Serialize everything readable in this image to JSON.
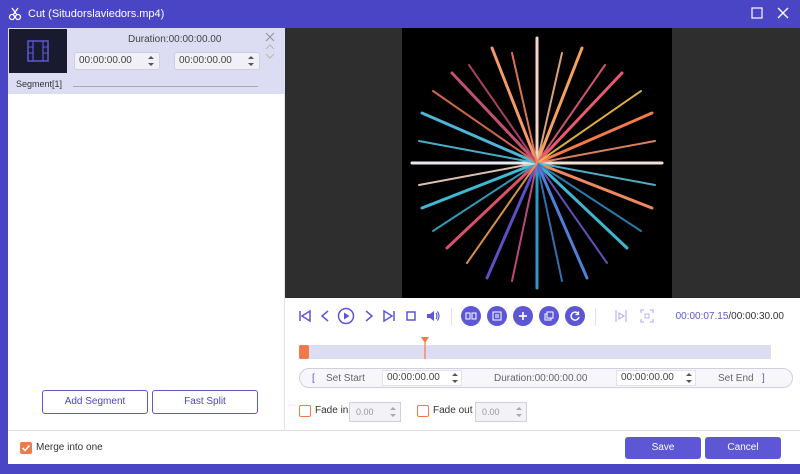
{
  "window": {
    "title": "Cut (Situdorslaviedors.mp4)"
  },
  "segment": {
    "duration_label": "Duration:00:00:00.00",
    "start_time": "00:00:00.00",
    "end_time": "00:00:00.00",
    "label": "Segment[1]"
  },
  "left_buttons": {
    "add_segment": "Add Segment",
    "fast_split": "Fast Split"
  },
  "playback": {
    "current_time": "00:00:07.15",
    "total_time": "/00:00:30.00"
  },
  "set_row": {
    "set_start": "Set Start",
    "start_time": "00:00:00.00",
    "duration_label": "Duration:00:00:00.00",
    "end_time": "00:00:00.00",
    "set_end": "Set End"
  },
  "fade": {
    "fade_in_label": "Fade in",
    "fade_in_value": "0.00",
    "fade_out_label": "Fade out",
    "fade_out_value": "0.00"
  },
  "bottom": {
    "merge_label": "Merge into one",
    "save": "Save",
    "cancel": "Cancel"
  },
  "colors": {
    "accent": "#5d57d6",
    "titlebar": "#4a45c4",
    "orange": "#f07a4a",
    "panel": "#dcdcf3"
  },
  "icons": [
    "scissors-icon",
    "maximize-icon",
    "close-icon",
    "film-icon",
    "jump-start-icon",
    "prev-frame-icon",
    "play-icon",
    "next-frame-icon",
    "jump-end-icon",
    "stop-icon",
    "volume-icon",
    "split-icon",
    "segment-list-icon",
    "add-icon",
    "copy-icon",
    "reset-icon",
    "preview-icon",
    "fullscreen-icon"
  ]
}
